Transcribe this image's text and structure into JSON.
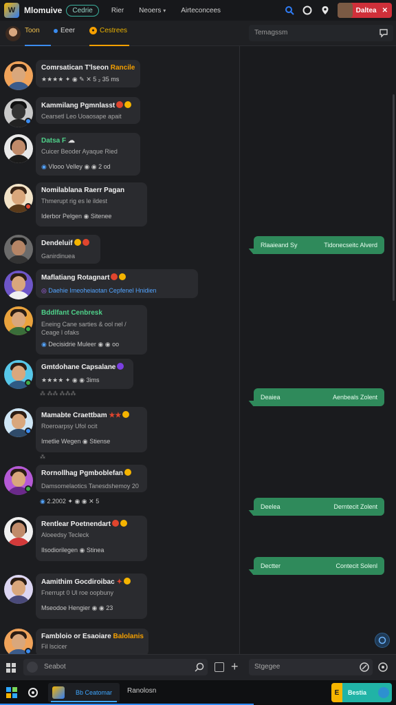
{
  "topbar": {
    "logo_text": "W",
    "app_name": "Mlomuive",
    "pill_label": "Cedrie",
    "nav": [
      "Rier",
      "Neoers",
      "Airteconcees"
    ],
    "profile_label": "Daltea"
  },
  "tabs": [
    {
      "label": "Toon"
    },
    {
      "label": "Eeer"
    },
    {
      "label": "Cestrees"
    }
  ],
  "right_search": {
    "placeholder": "Temagssm"
  },
  "conversations": [
    {
      "name": "Comrsatican T'lseon",
      "name_extra": "Rancile",
      "sub": "",
      "meta": "★★★★ ✦ ◉ ✎ ✕ 5 ₂ 35 ms",
      "time": "",
      "name_color": "default"
    },
    {
      "name": "Kammilang Pgmnlasst",
      "name_extra": "",
      "sub": "Cearsetl Leo Uoaosape apait",
      "meta": "",
      "time": "",
      "name_color": "default"
    },
    {
      "name": "Datsa F",
      "name_extra": "",
      "sub": "Cuicer Beoder Ayaque Ried",
      "meta": "Vlooo Velley ◉ ◉ 2 od",
      "time": "",
      "name_color": "green"
    },
    {
      "name": "Nomilablana Raerr Pagan",
      "name_extra": "",
      "sub": "Thmerupt rig es le ildest",
      "meta": "Iderbor Pelgen ◉ Sitenee",
      "time": "",
      "name_color": "default"
    },
    {
      "name": "Dendeluif",
      "name_extra": "",
      "sub": "Ganirdinuea",
      "meta": "",
      "time": "",
      "name_color": "default"
    },
    {
      "name": "Maflatiang Rotagnart",
      "name_extra": "",
      "sub": "Daehie Imeoheiaotan Cepfenel Hnidien",
      "meta": "",
      "time": "",
      "name_color": "default"
    },
    {
      "name": "Bddlfant Cenbresk",
      "name_extra": "",
      "sub": "Eneing Cane sarties & ool nel / Ceage l ofaks",
      "meta": "Decisidrie Muleer ◉ ◉ oo",
      "time": "",
      "name_color": "green"
    },
    {
      "name": "Gmtdohane Capsalane",
      "name_extra": "",
      "sub": "",
      "meta": "★★★★ ✦ ◉ ◉ 3ims",
      "time": "",
      "name_color": "default"
    },
    {
      "name": "Mamabte Craettbam",
      "name_extra": "",
      "sub": "Roeroarpsy Ufol ocit",
      "meta": "Imetlie Wegen ◉ Stiense",
      "time": "",
      "name_color": "default"
    },
    {
      "name": "Rornollhag Pgmboblefan",
      "name_extra": "",
      "sub": "Damsomelaotics Tanesdshemoy 20",
      "meta": "2.2002 ✦ ◉ ◉ ✕ 5",
      "time": "",
      "name_color": "default"
    },
    {
      "name": "Rentlear Poetnendart",
      "name_extra": "",
      "sub": "Aloeedsy Tecleck",
      "meta": "Ilsodiorilegen ◉ Stinea",
      "time": "",
      "name_color": "default"
    },
    {
      "name": "Aamithim Gocdiroibac",
      "name_extra": "",
      "sub": "Fnerrupt 0 Ul roe oopbuny",
      "meta": "Mseodoe Hengier ◉ ◉ 23",
      "time": "",
      "name_color": "default"
    },
    {
      "name": "Fambloio or Esaoiare",
      "name_extra": "Balolanis",
      "sub": "Fil lscicer",
      "meta": "",
      "time": "",
      "name_color": "default"
    }
  ],
  "outgoing": [
    {
      "left": "Rlaaieand Sy",
      "right": "Tidonecseitc Alverd"
    },
    {
      "left": "Deaiea",
      "right": "Aenbeals Zolent"
    },
    {
      "left": "Deelea",
      "right": "Derntecit Zolent"
    },
    {
      "left": "Dectter",
      "right": "Contecit Solenl"
    }
  ],
  "composer": {
    "left_placeholder": "Seabot",
    "right_placeholder": "Stgegee"
  },
  "taskbar": {
    "app_label": "Bb Ceatomar",
    "window_title": "Ranolosn",
    "right_letter": "E",
    "right_label": "Bestia"
  },
  "progress": 0.64,
  "colors": {
    "accent_blue": "#3a8cf0",
    "accent_green": "#2f8a5b",
    "accent_yellow": "#f5b400",
    "accent_red": "#d0303a"
  }
}
